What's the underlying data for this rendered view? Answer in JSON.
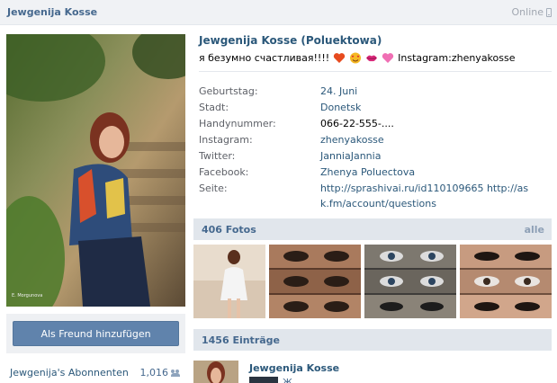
{
  "topbar": {
    "title": "Jewgenija Kosse",
    "online": "Online"
  },
  "profile": {
    "full_name": "Jewgenija Kosse (Poluektowa)",
    "status_text": "я безумно счастливая!!!!",
    "status_suffix": "Instagram:zhenyakosse"
  },
  "info": [
    {
      "label": "Geburtstag:",
      "value": "24. Juni",
      "link": true
    },
    {
      "label": "Stadt:",
      "value": "Donetsk",
      "link": true
    },
    {
      "label": "Handynummer:",
      "value": "066-22-555-....",
      "link": false
    },
    {
      "label": "Instagram:",
      "value": "zhenyakosse",
      "link": true
    },
    {
      "label": "Twitter:",
      "value": "JanniaJannia",
      "link": true
    },
    {
      "label": "Facebook:",
      "value": "Zhenya Poluectova",
      "link": true
    },
    {
      "label": "Seite:",
      "value": "http://sprashivai.ru/id110109665 http://ask.fm/account/questions",
      "link": true
    }
  ],
  "actions": {
    "add_friend": "Als Freund hinzufügen"
  },
  "subscribers": {
    "label": "Jewgenija's Abonnenten",
    "count": "1,016"
  },
  "photos": {
    "title": "406 Fotos",
    "all": "alle"
  },
  "wall": {
    "title": "1456 Einträge",
    "post_author": "Jewgenija Kosse",
    "post_fragment": "Ж"
  },
  "icons": {
    "online": "mobile-phone-icon",
    "subscribers": "people-icon"
  },
  "colors": {
    "link": "#2b587a",
    "header_bg": "#e1e6ec",
    "button": "#6083ac"
  }
}
